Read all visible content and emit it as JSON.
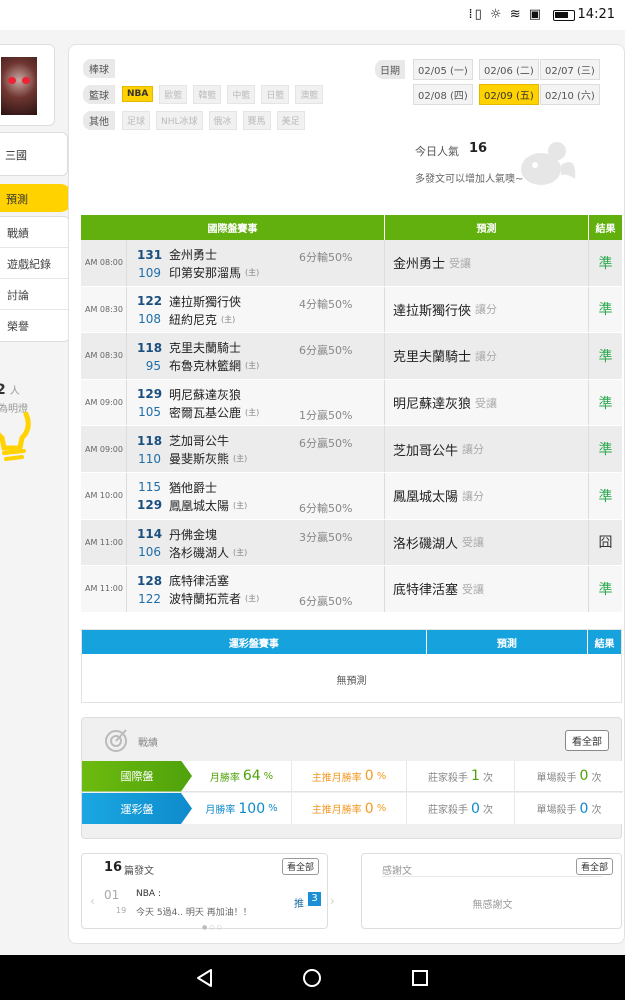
{
  "status_bar": {
    "icons": "⁞▯ ☼ ≋ ▣",
    "time": "14:21"
  },
  "sidebar": {
    "username": "三國",
    "nav_active": "預測",
    "nav_items": [
      {
        "label": "戰績"
      },
      {
        "label": "遊戲紀錄"
      },
      {
        "label": "討論"
      },
      {
        "label": "榮譽"
      }
    ],
    "popularity_count": "2",
    "popularity_unit": "人",
    "popularity_label": "為明燈"
  },
  "filters": {
    "rows": [
      {
        "category": "棒球",
        "chips": []
      },
      {
        "category": "籃球",
        "chips": [
          {
            "label": "NBA",
            "active": true
          },
          {
            "label": "歐籃"
          },
          {
            "label": "韓籃"
          },
          {
            "label": "中籃"
          },
          {
            "label": "日籃"
          },
          {
            "label": "澳籃"
          }
        ]
      },
      {
        "category": "其他",
        "chips": [
          {
            "label": "足球"
          },
          {
            "label": "NHL冰球"
          },
          {
            "label": "俄冰"
          },
          {
            "label": "賽馬"
          },
          {
            "label": "美足"
          }
        ]
      }
    ]
  },
  "dates": {
    "label": "日期",
    "items": [
      {
        "label": "02/05 (一)"
      },
      {
        "label": "02/06 (二)"
      },
      {
        "label": "02/07 (三)"
      },
      {
        "label": "02/08 (四)"
      },
      {
        "label": "02/09 (五)",
        "active": true
      },
      {
        "label": "02/10 (六)"
      }
    ]
  },
  "today": {
    "label": "今日人氣",
    "count": "16",
    "tip": "多發文可以增加人氣噢~"
  },
  "intl_table": {
    "headers": {
      "game": "國際盤賽事",
      "prediction": "預測",
      "result": "結果"
    },
    "rows": [
      {
        "time": "AM 08:00",
        "away_num": "131",
        "away": "金州勇士",
        "home_num": "109",
        "home": "印第安那溜馬",
        "home_tag": "(主)",
        "spread": "6分輸50%",
        "spread_pos": "top",
        "winner": "away",
        "pick": "金州勇士",
        "note": "受讓",
        "result": "準",
        "result_type": "win"
      },
      {
        "time": "AM 08:30",
        "away_num": "122",
        "away": "達拉斯獨行俠",
        "home_num": "108",
        "home": "紐約尼克",
        "home_tag": "(主)",
        "spread": "4分輸50%",
        "spread_pos": "top",
        "winner": "away",
        "pick": "達拉斯獨行俠",
        "note": "讓分",
        "result": "準",
        "result_type": "win"
      },
      {
        "time": "AM 08:30",
        "away_num": "118",
        "away": "克里夫蘭騎士",
        "home_num": "95",
        "home": "布魯克林籃網",
        "home_tag": "(主)",
        "spread": "6分贏50%",
        "spread_pos": "top",
        "winner": "away",
        "pick": "克里夫蘭騎士",
        "note": "讓分",
        "result": "準",
        "result_type": "win"
      },
      {
        "time": "AM 09:00",
        "away_num": "129",
        "away": "明尼蘇達灰狼",
        "home_num": "105",
        "home": "密爾瓦基公鹿",
        "home_tag": "(主)",
        "spread": "1分贏50%",
        "spread_pos": "bot",
        "winner": "away",
        "pick": "明尼蘇達灰狼",
        "note": "受讓",
        "result": "準",
        "result_type": "win"
      },
      {
        "time": "AM 09:00",
        "away_num": "118",
        "away": "芝加哥公牛",
        "home_num": "110",
        "home": "曼斐斯灰熊",
        "home_tag": "(主)",
        "spread": "6分贏50%",
        "spread_pos": "top",
        "winner": "away",
        "pick": "芝加哥公牛",
        "note": "讓分",
        "result": "準",
        "result_type": "win"
      },
      {
        "time": "AM 10:00",
        "away_num": "115",
        "away": "猶他爵士",
        "home_num": "129",
        "home": "鳳凰城太陽",
        "home_tag": "(主)",
        "spread": "6分輸50%",
        "spread_pos": "bot",
        "winner": "home",
        "pick": "鳳凰城太陽",
        "note": "讓分",
        "result": "準",
        "result_type": "win"
      },
      {
        "time": "AM 11:00",
        "away_num": "114",
        "away": "丹佛金塊",
        "home_num": "106",
        "home": "洛杉磯湖人",
        "home_tag": "(主)",
        "spread": "3分贏50%",
        "spread_pos": "top",
        "winner": "away",
        "pick": "洛杉磯湖人",
        "note": "受讓",
        "result": "囧",
        "result_type": "lose"
      },
      {
        "time": "AM 11:00",
        "away_num": "128",
        "away": "底特律活塞",
        "home_num": "122",
        "home": "波特蘭拓荒者",
        "home_tag": "(主)",
        "spread": "6分贏50%",
        "spread_pos": "bot",
        "winner": "away",
        "pick": "底特律活塞",
        "note": "受讓",
        "result": "準",
        "result_type": "win"
      }
    ]
  },
  "lottery_table": {
    "headers": {
      "game": "運彩盤賽事",
      "prediction": "預測",
      "result": "結果"
    },
    "empty": "無預測"
  },
  "record": {
    "title": "戰績",
    "view_all": "看全部",
    "rows": [
      {
        "label": "國際盤",
        "month_label": "月勝率",
        "month_value": "64",
        "month_unit": "%",
        "main_label": "主推月勝率",
        "main_value": "0",
        "main_unit": "%",
        "banker_label": "莊家殺手",
        "banker_value": "1",
        "banker_unit": "次",
        "single_label": "單場殺手",
        "single_value": "0",
        "single_unit": "次"
      },
      {
        "label": "運彩盤",
        "month_label": "月勝率",
        "month_value": "100",
        "month_unit": "%",
        "main_label": "主推月勝率",
        "main_value": "0",
        "main_unit": "%",
        "banker_label": "莊家殺手",
        "banker_value": "0",
        "banker_unit": "次",
        "single_label": "單場殺手",
        "single_value": "0",
        "single_unit": "次"
      }
    ]
  },
  "posts": {
    "count": "16",
    "label": "篇發文",
    "view_all": "看全部",
    "item": {
      "day": "01",
      "month": "19",
      "title": "NBA :",
      "text": "今天 5過4.. 明天 再加油！！",
      "push_label": "推",
      "push_count": "3"
    },
    "dots": "●○○"
  },
  "thanks": {
    "label": "感謝文",
    "view_all": "看全部",
    "empty": "無感謝文"
  },
  "colors": {
    "accent": "#ffd200",
    "intl_green": "#61b00d",
    "lottery_blue": "#15a2dd",
    "win_green": "#2da94f"
  }
}
